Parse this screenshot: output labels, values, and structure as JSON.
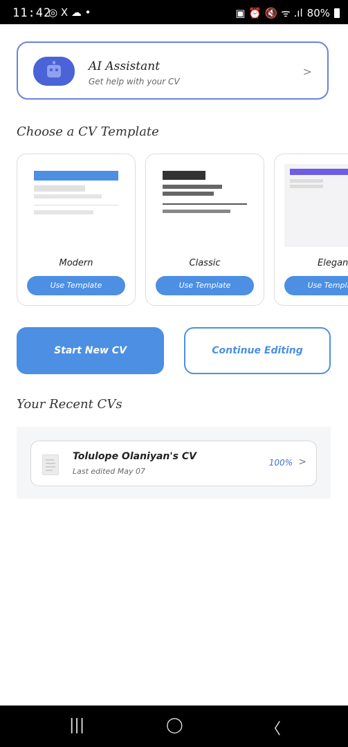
{
  "status_bar": {
    "time": "11:42",
    "left_icons": "◎ X ☁ •",
    "right_icons": "▣ ⏰ 🔇 ᯤ .ıl",
    "battery": "80%"
  },
  "ai_assistant": {
    "title": "AI Assistant",
    "subtitle": "Get help with your CV",
    "chevron": ">",
    "icon": "robot-icon"
  },
  "templates_section": {
    "title": "Choose a CV Template",
    "items": [
      {
        "name": "Modern",
        "button": "Use Template"
      },
      {
        "name": "Classic",
        "button": "Use Template"
      },
      {
        "name": "Elegant",
        "button": "Use Template"
      }
    ]
  },
  "actions": {
    "start_new": "Start New CV",
    "continue_editing": "Continue Editing"
  },
  "recent": {
    "title": "Your Recent CVs",
    "items": [
      {
        "title": "Tolulope Olaniyan's CV",
        "subtitle": "Last edited May 07",
        "progress": "100%",
        "chevron": ">"
      }
    ]
  },
  "nav": {
    "recents": "|||",
    "home": "◯",
    "back": "〈"
  },
  "colors": {
    "accent": "#4c8fe3",
    "ai_border": "#6a82d8",
    "ai_icon": "#4a63d6",
    "elegant_header": "#6c5ce7"
  }
}
